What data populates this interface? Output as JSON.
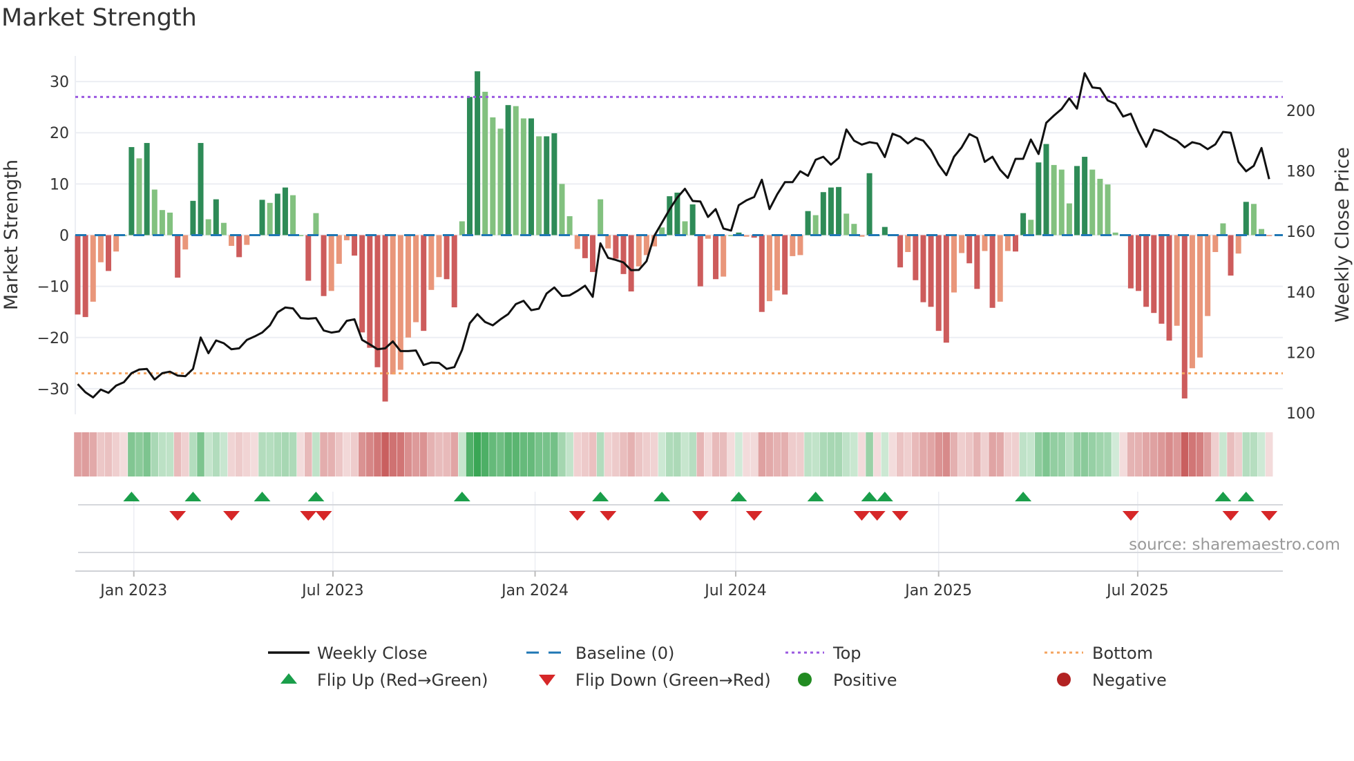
{
  "title": "Market Strength",
  "source": "source: sharemaestro.com",
  "colors": {
    "pos_strong": "#2e8b57",
    "pos_weak": "#82c17f",
    "neg_strong": "#cd5c5c",
    "neg_weak": "#e9967a",
    "heat_pos": "#3aa655",
    "heat_neg": "#c95f5f",
    "line": "#111111",
    "baseline": "#1f77b4",
    "top": "#9b59e0",
    "bottom": "#f4a460",
    "flip_up": "#1a9e4a",
    "flip_down": "#d62728",
    "positive": "#228b22",
    "negative": "#b22222"
  },
  "chart_data": {
    "type": "bar",
    "title": "Market Strength",
    "ylabel": "Market Strength",
    "y2label": "Weekly Close Price",
    "ylim": [
      -35,
      35
    ],
    "y2lim": [
      99.6,
      218
    ],
    "yticks": [
      -30,
      -20,
      -10,
      0,
      10,
      20,
      30
    ],
    "ytick_labels": [
      "−30",
      "−20",
      "−10",
      "0",
      "10",
      "20",
      "30"
    ],
    "y2ticks": [
      100,
      120,
      140,
      160,
      180,
      200
    ],
    "y2tick_labels": [
      "100",
      "120",
      "140",
      "160",
      "180",
      "200"
    ],
    "x_ticks": [
      {
        "label": "Jan 2023",
        "week": 7.3
      },
      {
        "label": "Jul 2023",
        "week": 33.2
      },
      {
        "label": "Jan 2024",
        "week": 59.5
      },
      {
        "label": "Jul 2024",
        "week": 85.6
      },
      {
        "label": "Jan 2025",
        "week": 112
      },
      {
        "label": "Jul 2025",
        "week": 137.9
      }
    ],
    "top": 27,
    "bottom": -27,
    "baseline": 0,
    "grid": true,
    "strength": [
      -15.5,
      -16,
      -13,
      -5.3,
      -7,
      -3.2,
      0,
      17.2,
      15,
      18,
      8.9,
      4.9,
      4.4,
      -8.3,
      -2.8,
      6.7,
      18,
      3.1,
      7,
      2.4,
      -2.1,
      -4.3,
      -1.9,
      0,
      6.9,
      6.3,
      8.1,
      9.3,
      7.8,
      0,
      -8.9,
      4.3,
      -11.9,
      -10.9,
      -5.6,
      -1,
      -4,
      -19,
      -22,
      -25.8,
      -32.5,
      -27.2,
      -26.3,
      -20,
      -17,
      -18.7,
      -10.7,
      -8.2,
      -8.6,
      -14.1,
      2.7,
      27,
      32,
      28,
      23,
      20.8,
      25.4,
      25.2,
      22.8,
      22.8,
      19.3,
      19.3,
      19.9,
      10,
      3.7,
      -2.7,
      -4.5,
      -7.2,
      7,
      -2.6,
      -4.6,
      -7.6,
      -11,
      -6.1,
      -3.9,
      -2.2,
      1.5,
      7.6,
      8.3,
      2.7,
      6,
      -10,
      -0.7,
      -8.6,
      -8.1,
      0,
      0.5,
      -0.3,
      -0.5,
      -15,
      -12.9,
      -10.8,
      -11.6,
      -4.1,
      -3.9,
      4.7,
      3.9,
      8.4,
      9.3,
      9.4,
      4.2,
      2.2,
      -0.3,
      12.1,
      0,
      1.6,
      0,
      -6.3,
      -3.3,
      -8.8,
      -13.1,
      -14,
      -18.7,
      -21,
      -11.2,
      -3.5,
      -5.5,
      -10.5,
      -3.1,
      -14.2,
      -13,
      -3.1,
      -3.2,
      4.3,
      3,
      14.2,
      17.8,
      13.7,
      12.8,
      6.2,
      13.5,
      15.3,
      12.8,
      11,
      9.9,
      0.5,
      0,
      -10.4,
      -10.9,
      -14,
      -15.2,
      -17.3,
      -20.6,
      -17.7,
      -31.9,
      -26,
      -23.9,
      -15.8,
      -3.3,
      2.3,
      -7.9,
      -3.6,
      6.5,
      6.1,
      1.2,
      -0.2
    ],
    "weekly_close": [
      109.6,
      106.9,
      105.2,
      107.8,
      106.7,
      109.1,
      110.2,
      113.2,
      114.4,
      114.6,
      111.1,
      113.2,
      113.7,
      112.4,
      112.2,
      114.6,
      125,
      119.8,
      124,
      123.1,
      121.1,
      121.4,
      124.2,
      125.3,
      126.6,
      129,
      133.3,
      134.9,
      134.6,
      131.4,
      131.2,
      131.4,
      127.3,
      126.6,
      127,
      130.5,
      131,
      124.2,
      122.7,
      121.1,
      121.4,
      123.7,
      120.5,
      120.5,
      120.7,
      115.9,
      116.7,
      116.6,
      114.6,
      115.2,
      120.9,
      129.7,
      132.7,
      130.1,
      129,
      131,
      132.7,
      136,
      137.1,
      134,
      134.5,
      139.5,
      141.5,
      138.7,
      138.9,
      140.4,
      142.1,
      138.4,
      156.1,
      151.3,
      150.6,
      149.8,
      147.2,
      147.3,
      150.2,
      158.5,
      162.9,
      167.3,
      171.2,
      174.1,
      170.1,
      169.9,
      164.8,
      167.4,
      161,
      160.3,
      168.7,
      170.3,
      171.4,
      177.1,
      167.4,
      172.3,
      176.3,
      176.3,
      179.9,
      178.4,
      183.7,
      184.7,
      182.1,
      184.3,
      193.7,
      190,
      188.7,
      189.5,
      189.1,
      184.6,
      192.3,
      191.3,
      189.1,
      190.9,
      190,
      186.9,
      182.1,
      178.6,
      184.7,
      187.8,
      192.2,
      190.9,
      183,
      184.7,
      180.4,
      177.7,
      184,
      184,
      190.4,
      185.6,
      195.9,
      198.3,
      200.5,
      204,
      200.6,
      212.3,
      207.6,
      207.3,
      203.3,
      202.2,
      198,
      198.9,
      193,
      188,
      193.7,
      193,
      191.3,
      190,
      187.8,
      189.5,
      188.9,
      187.2,
      188.8,
      192.9,
      192.6,
      183,
      179.9,
      181.7,
      187.6,
      177.3
    ],
    "flip_up_weeks": [
      7,
      15,
      24,
      31,
      50,
      68,
      76,
      86,
      96,
      103,
      105,
      123,
      149,
      152
    ],
    "flip_down_weeks": [
      13,
      20,
      30,
      32,
      65,
      69,
      81,
      88,
      102,
      104,
      107,
      137,
      150,
      155
    ],
    "legend": [
      {
        "key": "weekly_close",
        "label": "Weekly Close"
      },
      {
        "key": "baseline",
        "label": "Baseline (0)"
      },
      {
        "key": "top",
        "label": "Top"
      },
      {
        "key": "bottom",
        "label": "Bottom"
      },
      {
        "key": "flip_up",
        "label": "Flip Up (Red→Green)"
      },
      {
        "key": "flip_down",
        "label": "Flip Down (Green→Red)"
      },
      {
        "key": "positive",
        "label": "Positive"
      },
      {
        "key": "negative",
        "label": "Negative"
      }
    ],
    "legend_position": "bottom"
  }
}
